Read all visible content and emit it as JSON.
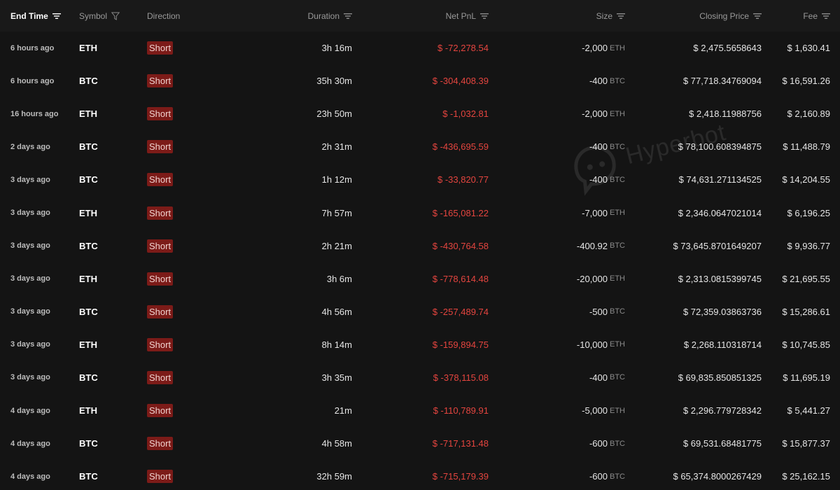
{
  "headers": {
    "end_time": "End Time",
    "symbol": "Symbol",
    "direction": "Direction",
    "duration": "Duration",
    "net_pnl": "Net PnL",
    "size": "Size",
    "closing_price": "Closing Price",
    "fee": "Fee"
  },
  "icons": {
    "sort": "sort-lines-icon",
    "filter": "funnel-filter-icon"
  },
  "colors": {
    "background": "#141414",
    "header_background": "#191919",
    "loss_red": "#e5453f",
    "short_badge": "#7c1b18"
  },
  "watermark": {
    "text": "Hyperbot"
  },
  "rows": [
    {
      "end_time": "6 hours ago",
      "symbol": "ETH",
      "direction": "Short",
      "duration": "3h 16m",
      "net_pnl": "$ -72,278.54",
      "size": "-2,000",
      "size_unit": "ETH",
      "closing_price": "$ 2,475.5658643",
      "fee": "$ 1,630.41"
    },
    {
      "end_time": "6 hours ago",
      "symbol": "BTC",
      "direction": "Short",
      "duration": "35h 30m",
      "net_pnl": "$ -304,408.39",
      "size": "-400",
      "size_unit": "BTC",
      "closing_price": "$ 77,718.34769094",
      "fee": "$ 16,591.26"
    },
    {
      "end_time": "16 hours ago",
      "symbol": "ETH",
      "direction": "Short",
      "duration": "23h 50m",
      "net_pnl": "$ -1,032.81",
      "size": "-2,000",
      "size_unit": "ETH",
      "closing_price": "$ 2,418.11988756",
      "fee": "$ 2,160.89"
    },
    {
      "end_time": "2 days ago",
      "symbol": "BTC",
      "direction": "Short",
      "duration": "2h 31m",
      "net_pnl": "$ -436,695.59",
      "size": "-400",
      "size_unit": "BTC",
      "closing_price": "$ 78,100.608394875",
      "fee": "$ 11,488.79"
    },
    {
      "end_time": "3 days ago",
      "symbol": "BTC",
      "direction": "Short",
      "duration": "1h 12m",
      "net_pnl": "$ -33,820.77",
      "size": "-400",
      "size_unit": "BTC",
      "closing_price": "$ 74,631.271134525",
      "fee": "$ 14,204.55"
    },
    {
      "end_time": "3 days ago",
      "symbol": "ETH",
      "direction": "Short",
      "duration": "7h 57m",
      "net_pnl": "$ -165,081.22",
      "size": "-7,000",
      "size_unit": "ETH",
      "closing_price": "$ 2,346.0647021014",
      "fee": "$ 6,196.25"
    },
    {
      "end_time": "3 days ago",
      "symbol": "BTC",
      "direction": "Short",
      "duration": "2h 21m",
      "net_pnl": "$ -430,764.58",
      "size": "-400.92",
      "size_unit": "BTC",
      "closing_price": "$ 73,645.8701649207",
      "fee": "$ 9,936.77"
    },
    {
      "end_time": "3 days ago",
      "symbol": "ETH",
      "direction": "Short",
      "duration": "3h 6m",
      "net_pnl": "$ -778,614.48",
      "size": "-20,000",
      "size_unit": "ETH",
      "closing_price": "$ 2,313.0815399745",
      "fee": "$ 21,695.55"
    },
    {
      "end_time": "3 days ago",
      "symbol": "BTC",
      "direction": "Short",
      "duration": "4h 56m",
      "net_pnl": "$ -257,489.74",
      "size": "-500",
      "size_unit": "BTC",
      "closing_price": "$ 72,359.03863736",
      "fee": "$ 15,286.61"
    },
    {
      "end_time": "3 days ago",
      "symbol": "ETH",
      "direction": "Short",
      "duration": "8h 14m",
      "net_pnl": "$ -159,894.75",
      "size": "-10,000",
      "size_unit": "ETH",
      "closing_price": "$ 2,268.110318714",
      "fee": "$ 10,745.85"
    },
    {
      "end_time": "3 days ago",
      "symbol": "BTC",
      "direction": "Short",
      "duration": "3h 35m",
      "net_pnl": "$ -378,115.08",
      "size": "-400",
      "size_unit": "BTC",
      "closing_price": "$ 69,835.850851325",
      "fee": "$ 11,695.19"
    },
    {
      "end_time": "4 days ago",
      "symbol": "ETH",
      "direction": "Short",
      "duration": "21m",
      "net_pnl": "$ -110,789.91",
      "size": "-5,000",
      "size_unit": "ETH",
      "closing_price": "$ 2,296.779728342",
      "fee": "$ 5,441.27"
    },
    {
      "end_time": "4 days ago",
      "symbol": "BTC",
      "direction": "Short",
      "duration": "4h 58m",
      "net_pnl": "$ -717,131.48",
      "size": "-600",
      "size_unit": "BTC",
      "closing_price": "$ 69,531.68481775",
      "fee": "$ 15,877.37"
    },
    {
      "end_time": "4 days ago",
      "symbol": "BTC",
      "direction": "Short",
      "duration": "32h 59m",
      "net_pnl": "$ -715,179.39",
      "size": "-600",
      "size_unit": "BTC",
      "closing_price": "$ 65,374.8000267429",
      "fee": "$ 25,162.15"
    }
  ]
}
